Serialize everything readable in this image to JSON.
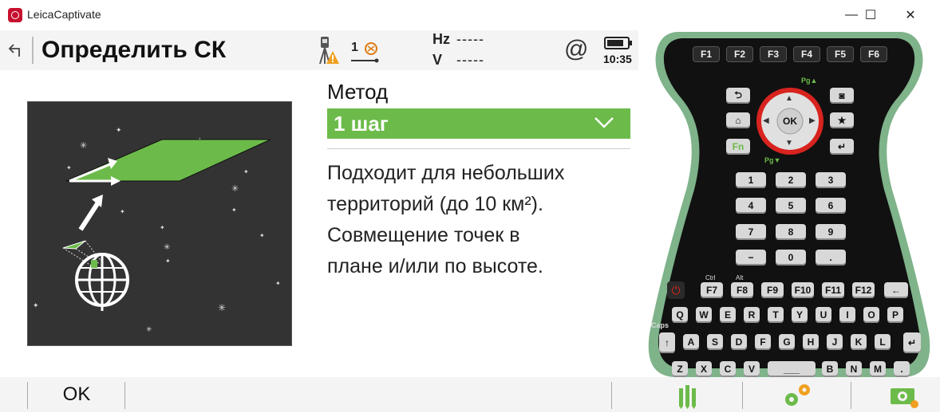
{
  "window": {
    "title": "LeicaCaptivate",
    "controls": {
      "minimize": "—",
      "maximize": "☐",
      "close": "✕"
    }
  },
  "header": {
    "title": "Определить СК",
    "status_number": "1",
    "hz_label": "Hz",
    "hz_value": "-----",
    "v_label": "V",
    "v_value": "-----",
    "connection_symbol": "@",
    "battery_level": 0.85,
    "time": "10:35"
  },
  "method": {
    "label": "Метод",
    "value": "1 шаг",
    "description_lines": [
      "Подходит для небольших",
      "территорий (до 10 км²).",
      "Совмещение точек в",
      "плане и/или по высоте."
    ]
  },
  "footer": {
    "ok_label": "OK",
    "icons": [
      "survey-tools-icon",
      "settings-gears-icon",
      "camera-settings-icon"
    ]
  },
  "keypad": {
    "function_keys": [
      "F1",
      "F2",
      "F3",
      "F4",
      "F5",
      "F6"
    ],
    "nav": {
      "ok": "OK",
      "fn": "Fn"
    },
    "numpad": [
      "1",
      "2",
      "3",
      "4",
      "5",
      "6",
      "7",
      "8",
      "9",
      "−",
      "0",
      "."
    ],
    "f_row": [
      "F7",
      "F8",
      "F9",
      "F10",
      "F11",
      "F12"
    ],
    "f_row_labels": {
      "ctrl": "Ctrl",
      "alt": "Alt"
    },
    "row_q": [
      "Q",
      "W",
      "E",
      "R",
      "T",
      "Y",
      "U",
      "I",
      "O",
      "P"
    ],
    "row_a": [
      "A",
      "S",
      "D",
      "F",
      "G",
      "H",
      "J",
      "K",
      "L"
    ],
    "row_z": [
      "Z",
      "X",
      "C",
      "V",
      "B",
      "N",
      "M"
    ],
    "caps_label": "Caps",
    "pg_up": "Pg▲",
    "pg_down": "Pg▼",
    "colors": {
      "body": "#111111",
      "rim": "#7fb38a",
      "nav_ring": "#d8231f",
      "accent": "#6cbb4a"
    }
  }
}
